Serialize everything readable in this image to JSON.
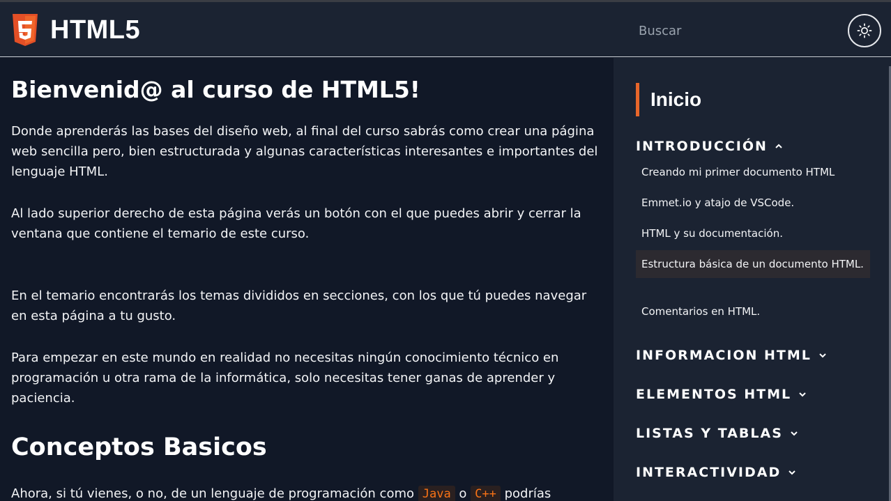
{
  "header": {
    "brand": "HTML5",
    "search_placeholder": "Buscar"
  },
  "main": {
    "title": "Bienvenid@ al curso de HTML5!",
    "paragraphs": [
      "Donde aprenderás las bases del diseño web, al final del curso sabrás como crear una página web sencilla pero, bien estructurada y algunas características interesantes e importantes del lenguaje HTML.",
      "Al lado superior derecho de esta página verás un botón con el que puedes abrir y cerrar la ventana que contiene el temario de este curso.",
      "En el temario encontrarás los temas divididos en secciones, con los que tú puedes navegar en esta página a tu gusto.",
      "Para empezar en este mundo en realidad no necesitas ningún conocimiento técnico en programación u otra rama de la informática, solo necesitas tener ganas de aprender y paciencia."
    ],
    "subtitle": "Conceptos Basicos",
    "last_paragraph": {
      "before": "Ahora, si tú vienes, o no, de un lenguaje de programación como ",
      "code1": "Java",
      "middle": " o ",
      "code2": "C++",
      "after": " podrías"
    }
  },
  "sidebar": {
    "inicio": "Inicio",
    "sections": [
      {
        "label": "INTRODUCCIÓN",
        "expanded": true
      },
      {
        "label": "INFORMACION HTML",
        "expanded": false
      },
      {
        "label": "ELEMENTOS HTML",
        "expanded": false
      },
      {
        "label": "LISTAS Y TABLAS",
        "expanded": false
      },
      {
        "label": "INTERACTIVIDAD",
        "expanded": false
      }
    ],
    "intro_items": [
      "Creando mi primer documento HTML",
      "Emmet.io y atajo de VSCode.",
      "HTML y su documentación.",
      "Estructura básica de un documento HTML.",
      "Comentarios en HTML."
    ]
  },
  "colors": {
    "accent": "#e8662a",
    "background": "#111827",
    "panel": "#1b2332"
  },
  "icons": {
    "logo": "html5-logo-icon",
    "theme": "sun-icon"
  }
}
